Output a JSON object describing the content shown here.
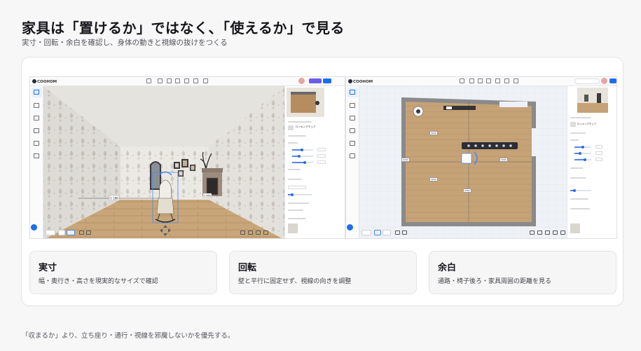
{
  "header": {
    "title": "家具は「置けるか」ではなく、「使えるか」で見る",
    "subtitle": "実寸・回転・余白を確認し、身体の動きと視線の抜けをつくる"
  },
  "screenshots": {
    "left": {
      "app_logo": "COOHOM",
      "view": "3d-perspective",
      "panel_item": "ロッキングチェア",
      "dimension_label": "1 186",
      "wall_dimension_label": "1 660",
      "icons": [
        "undo-icon",
        "redo-icon",
        "measure-icon",
        "camera-icon",
        "layers-icon",
        "settings-icon"
      ]
    },
    "right": {
      "app_logo": "COOHOM",
      "view": "2d-floorplan",
      "panel_item": "ロッキングチェア",
      "dimensions": [
        "4000",
        "2030",
        "2440",
        "1990",
        "2000"
      ]
    }
  },
  "features": [
    {
      "title": "実寸",
      "desc": "幅・奥行き・高さを現実的なサイズで確認"
    },
    {
      "title": "回転",
      "desc": "壁と平行に固定せず、視線の向きを調整"
    },
    {
      "title": "余白",
      "desc": "通路・椅子後ろ・家具周囲の距離を見る"
    }
  ],
  "footnote": "「収まるか」より、立ち座り・通行・視線を邪魔しないかを優先する。",
  "colors": {
    "accent": "#1d6fe6",
    "floor": "#c9a679",
    "wall": "#e7e5df"
  }
}
